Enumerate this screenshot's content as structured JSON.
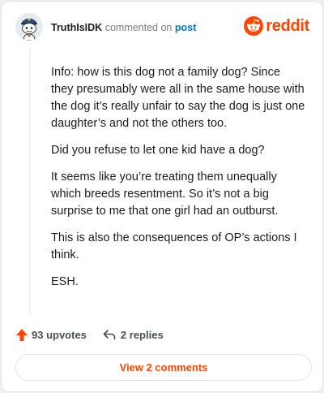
{
  "header": {
    "username": "TruthIsIDK",
    "action_text": "commented on",
    "post_link": "post",
    "brand": "reddit"
  },
  "comment": {
    "paragraphs": [
      "Info: how is this dog not a family dog? Since they presumably were all in the same house with the dog it’s really unfair to say the dog is just one daughter’s and not the others too.",
      "Did you refuse to let one kid have a dog?",
      "It seems like you’re treating them unequally which breeds resentment. So it’s not a big surprise to me that one girl had an outburst.",
      "This is also the consequences of OP’s actions I think.",
      "ESH."
    ]
  },
  "actions": {
    "upvotes": "93 upvotes",
    "replies": "2 replies"
  },
  "footer": {
    "view_comments": "View 2 comments"
  },
  "colors": {
    "brand": "#ff4500",
    "link": "#0079d3"
  },
  "icons": {
    "avatar": "snoo-avatar",
    "brand": "reddit-snoo-icon",
    "upvote": "upvote-arrow-icon",
    "reply": "reply-arrow-icon"
  }
}
